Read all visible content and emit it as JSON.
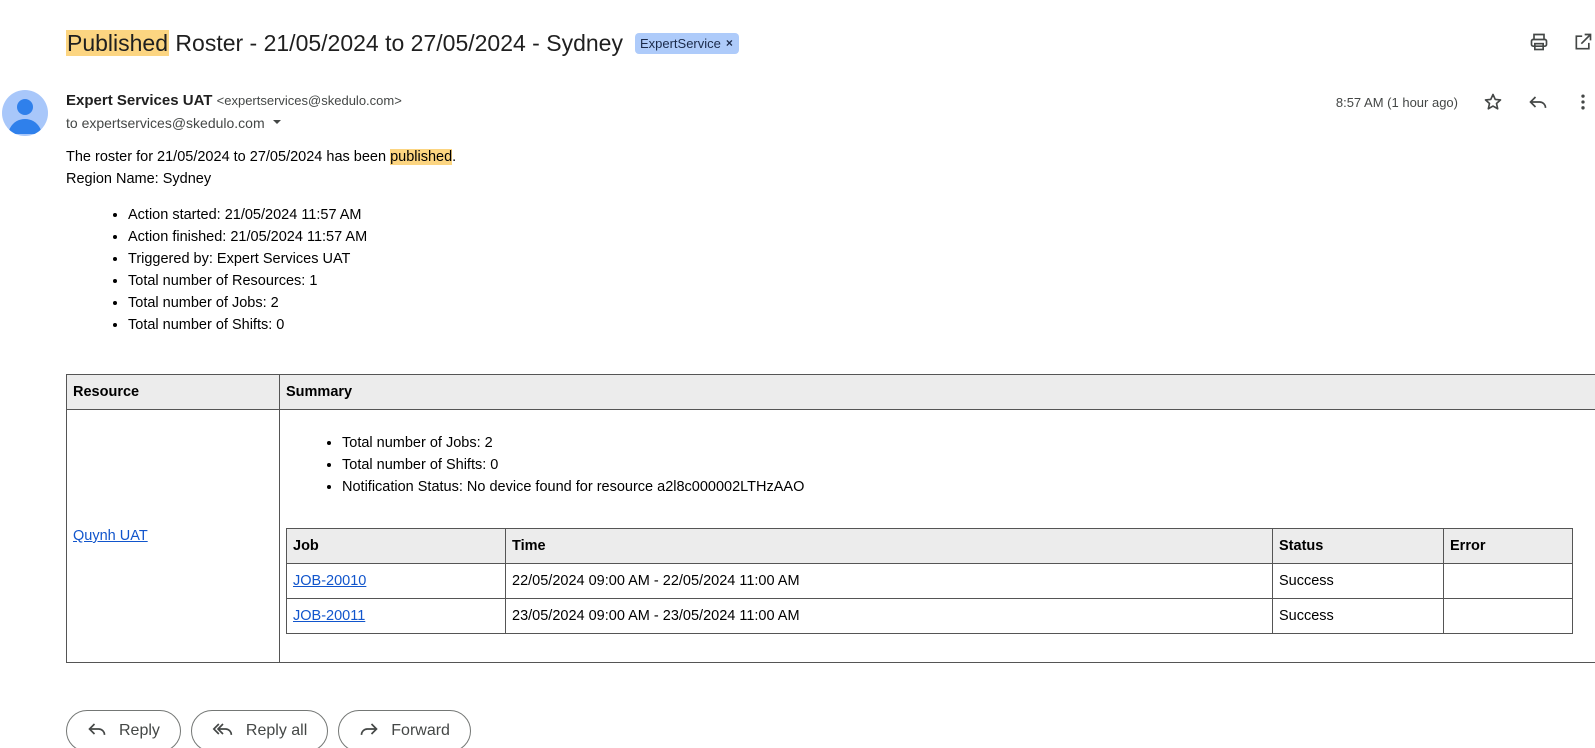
{
  "subject": {
    "highlight": "Published",
    "rest": " Roster - 21/05/2024 to 27/05/2024 - Sydney",
    "label": "ExpertService",
    "label_remove": "×"
  },
  "top_icons": [
    "print-icon",
    "open-in-new-window-icon"
  ],
  "sender": {
    "name": "Expert Services UAT",
    "email": "<expertservices@skedulo.com>",
    "to": "to expertservices@skedulo.com"
  },
  "header_actions": {
    "timestamp": "8:57 AM (1 hour ago)",
    "icons": [
      "star-icon",
      "reply-icon",
      "more-options-icon"
    ]
  },
  "body": {
    "intro_before": "The roster for 21/05/2024 to 27/05/2024 has been ",
    "intro_highlight": "published",
    "intro_after": ".",
    "region": "Region Name: Sydney",
    "meta": [
      "Action started: 21/05/2024 11:57 AM",
      "Action finished: 21/05/2024 11:57 AM",
      "Triggered by: Expert Services UAT",
      "Total number of Resources: 1",
      "Total number of Jobs: 2",
      "Total number of Shifts: 0"
    ]
  },
  "table": {
    "headers": [
      "Resource",
      "Summary"
    ],
    "resource": "Quynh UAT",
    "summary": [
      "Total number of Jobs: 2",
      "Total number of Shifts: 0",
      "Notification Status: No device found for resource a2l8c000002LTHzAAO"
    ],
    "job_headers": [
      "Job",
      "Time",
      "Status",
      "Error"
    ],
    "jobs": [
      {
        "job": "JOB-20010",
        "time": "22/05/2024 09:00 AM - 22/05/2024 11:00 AM",
        "status": "Success",
        "error": ""
      },
      {
        "job": "JOB-20011",
        "time": "23/05/2024 09:00 AM - 23/05/2024 11:00 AM",
        "status": "Success",
        "error": ""
      }
    ]
  },
  "actions": {
    "reply": "Reply",
    "reply_all": "Reply all",
    "forward": "Forward"
  },
  "colors": {
    "highlight": "#fcd581",
    "label_chip": "#aecbfa",
    "link": "#1155cc",
    "avatar": "#a8c7fa"
  }
}
